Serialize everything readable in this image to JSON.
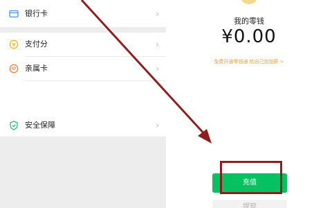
{
  "menu": {
    "items": [
      {
        "label": "银行卡",
        "icon": "bank-card-icon"
      },
      {
        "label": "支付分",
        "icon": "pay-score-icon"
      },
      {
        "label": "亲属卡",
        "icon": "family-card-icon"
      },
      {
        "label": "安全保障",
        "icon": "security-shield-icon"
      }
    ],
    "chevron": "›"
  },
  "wallet": {
    "title": "我的零钱",
    "balance": "¥0.00",
    "link": "免费开通零钱通 给自己加加薪 >",
    "recharge_label": "充值",
    "withdraw_label": "提现"
  },
  "colors": {
    "accent_green": "#07c160",
    "annotation_red": "#8b1f1f",
    "link_orange": "#e3a33b"
  }
}
